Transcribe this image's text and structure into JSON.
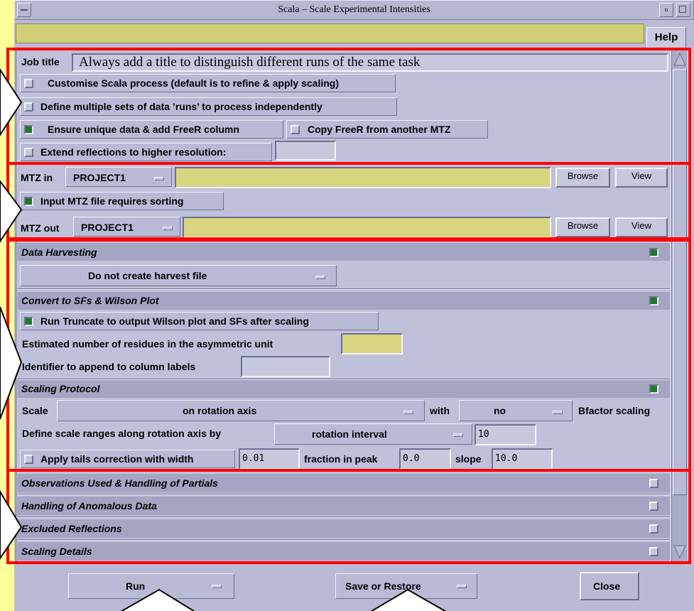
{
  "window": {
    "title": "Scala – Scale Experimental Intensities",
    "help_label": "Help"
  },
  "job": {
    "label": "Job title",
    "value": "Always add a title to distinguish different runs of the same task"
  },
  "options": {
    "customise": "Customise Scala process (default is to refine & apply scaling)",
    "multiple_runs": "Define multiple sets of data ’runs’ to process independently",
    "freer": "Ensure unique data & add FreeR column",
    "copy_freer": "Copy FreeR from another MTZ",
    "extend": "Extend reflections to higher resolution:"
  },
  "mtz_in": {
    "label": "MTZ in",
    "project": "PROJECT1",
    "browse": "Browse",
    "view": "View",
    "sorting": "Input MTZ file requires sorting"
  },
  "mtz_out": {
    "label": "MTZ out",
    "project": "PROJECT1",
    "browse": "Browse",
    "view": "View"
  },
  "harvest": {
    "title": "Data Harvesting",
    "option": "Do not create harvest file"
  },
  "convert": {
    "title": "Convert to SFs & Wilson Plot",
    "truncate": "Run Truncate to output Wilson plot and SFs after scaling",
    "residues": "Estimated number of residues in the asymmetric unit",
    "identifier": "Identifier to append to column labels"
  },
  "scaling": {
    "title": "Scaling Protocol",
    "scale_label": "Scale",
    "scale_value": "on rotation axis",
    "with_label": "with",
    "with_value": "no",
    "bfactor": "Bfactor scaling",
    "ranges_label": "Define scale ranges along rotation axis by",
    "ranges_value": "rotation interval",
    "ranges_num": "10",
    "tails_label": "Apply tails correction with width",
    "tails_width": "0.01",
    "fraction_label": "fraction in peak",
    "fraction_value": "0.0",
    "slope_label": "slope",
    "slope_value": "10.0"
  },
  "collapsed": {
    "observations": "Observations Used & Handling of Partials",
    "anomalous": "Handling of Anomalous Data",
    "excluded": "Excluded Reflections",
    "details": "Scaling Details"
  },
  "footer": {
    "run": "Run",
    "save": "Save or Restore",
    "close": "Close"
  },
  "colors": {
    "highlight": "#ff0000",
    "panel": "#b8bad6",
    "yellow_bg": "#fefe9a",
    "entry_yellow": "#d8d480",
    "check_on": "#1e7a26"
  }
}
